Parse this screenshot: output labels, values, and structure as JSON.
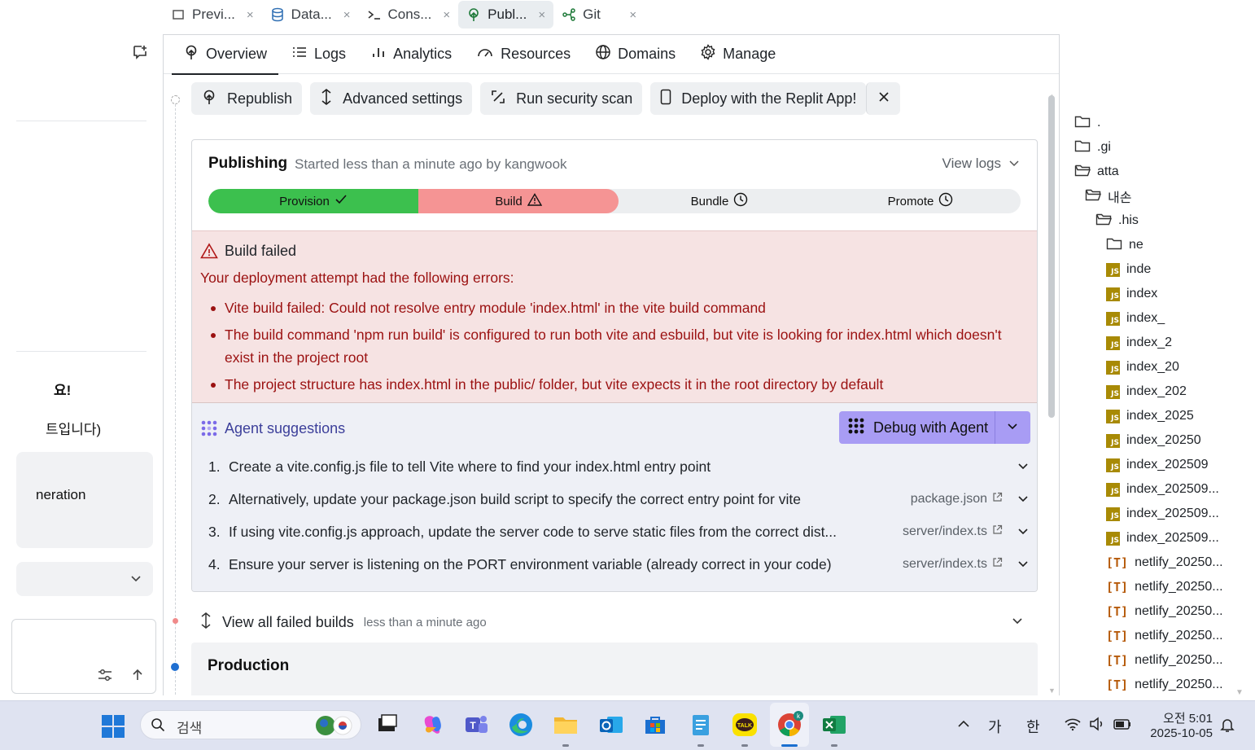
{
  "file_tabs": [
    {
      "label": "Previ...",
      "icon": "preview-icon",
      "close": "×"
    },
    {
      "label": "Data...",
      "icon": "database-icon",
      "close": "×"
    },
    {
      "label": "Cons...",
      "icon": "console-icon",
      "close": "×"
    },
    {
      "label": "Publ...",
      "icon": "publish-icon",
      "close": "×"
    },
    {
      "label": "Git",
      "icon": "git-icon",
      "close": "×"
    }
  ],
  "left_panel": {
    "heading_fragment": "요!",
    "subtitle_fragment": "트입니다)",
    "card_label": "neration"
  },
  "nav_tabs": [
    {
      "label": "Overview",
      "icon": "publish-icon"
    },
    {
      "label": "Logs",
      "icon": "list-icon"
    },
    {
      "label": "Analytics",
      "icon": "bar-chart-icon"
    },
    {
      "label": "Resources",
      "icon": "gauge-icon"
    },
    {
      "label": "Domains",
      "icon": "globe-icon"
    },
    {
      "label": "Manage",
      "icon": "gear-icon"
    }
  ],
  "actions": {
    "republish": "Republish",
    "advanced": "Advanced settings",
    "security": "Run security scan",
    "deploy_app": "Deploy with the Replit App!"
  },
  "publishing": {
    "title": "Publishing",
    "subtitle": "Started less than a minute ago by kangwook",
    "view_logs": "View logs",
    "steps": [
      {
        "label": "Provision",
        "status": "done",
        "color": "#3cc04e"
      },
      {
        "label": "Build",
        "status": "failed",
        "color": "#f59494"
      },
      {
        "label": "Bundle",
        "status": "pending"
      },
      {
        "label": "Promote",
        "status": "pending"
      }
    ]
  },
  "error": {
    "title": "Build failed",
    "intro": "Your deployment attempt had the following errors:",
    "items": [
      "Vite build failed: Could not resolve entry module 'index.html' in the vite build command",
      "The build command 'npm run build' is configured to run both vite and esbuild, but vite is looking for index.html which doesn't exist in the project root",
      "The project structure has index.html in the public/ folder, but vite expects it in the root directory by default"
    ]
  },
  "suggestions": {
    "title": "Agent suggestions",
    "debug_button": "Debug with Agent",
    "items": [
      {
        "num": "1.",
        "text": "Create a vite.config.js file to tell Vite where to find your index.html entry point",
        "file": ""
      },
      {
        "num": "2.",
        "text": "Alternatively, update your package.json build script to specify the correct entry point for vite",
        "file": "package.json"
      },
      {
        "num": "3.",
        "text": "If using vite.config.js approach, update the server code to serve static files from the correct dist...",
        "file": "server/index.ts"
      },
      {
        "num": "4.",
        "text": "Ensure your server is listening on the PORT environment variable (already correct in your code)",
        "file": "server/index.ts"
      }
    ]
  },
  "failed_builds": {
    "label": "View all failed builds",
    "time": "less than a minute ago"
  },
  "production": {
    "title": "Production"
  },
  "file_tree": [
    {
      "type": "folder",
      "label": ".",
      "indent": 0
    },
    {
      "type": "folder",
      "label": ".gi",
      "indent": 0
    },
    {
      "type": "folder-open",
      "label": "atta",
      "indent": 0
    },
    {
      "type": "folder-open",
      "label": "내손",
      "indent": 1
    },
    {
      "type": "folder-open",
      "label": ".his",
      "indent": 2
    },
    {
      "type": "folder",
      "label": "ne",
      "indent": 3
    },
    {
      "type": "js",
      "label": "inde",
      "indent": 3
    },
    {
      "type": "js",
      "label": "index",
      "indent": 3
    },
    {
      "type": "js",
      "label": "index_",
      "indent": 3
    },
    {
      "type": "js",
      "label": "index_2",
      "indent": 3
    },
    {
      "type": "js",
      "label": "index_20",
      "indent": 3
    },
    {
      "type": "js",
      "label": "index_202",
      "indent": 3
    },
    {
      "type": "js",
      "label": "index_2025",
      "indent": 3
    },
    {
      "type": "js",
      "label": "index_20250",
      "indent": 3
    },
    {
      "type": "js",
      "label": "index_202509",
      "indent": 3
    },
    {
      "type": "js",
      "label": "index_202509...",
      "indent": 3
    },
    {
      "type": "js",
      "label": "index_202509...",
      "indent": 3
    },
    {
      "type": "js",
      "label": "index_202509...",
      "indent": 3
    },
    {
      "type": "t",
      "label": "netlify_20250...",
      "indent": 3
    },
    {
      "type": "t",
      "label": "netlify_20250...",
      "indent": 3
    },
    {
      "type": "t",
      "label": "netlify_20250...",
      "indent": 3
    },
    {
      "type": "t",
      "label": "netlify_20250...",
      "indent": 3
    },
    {
      "type": "t",
      "label": "netlify_20250...",
      "indent": 3
    },
    {
      "type": "t",
      "label": "netlify_20250...",
      "indent": 3
    }
  ],
  "taskbar": {
    "search_placeholder": "검색",
    "ime_1": "가",
    "ime_2": "한",
    "time": "오전 5:01",
    "date": "2025-10-05"
  }
}
